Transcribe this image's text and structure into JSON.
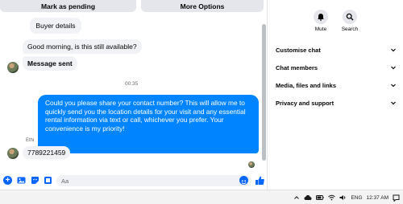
{
  "header_actions": {
    "mark_pending": "Mark as pending",
    "more_options": "More Options"
  },
  "messages": {
    "buyer_details": "Buyer details",
    "m1": "Good morning, is this still available?",
    "m2": "Message sent",
    "timestamp": "00:35",
    "outgoing": "Could you please share your contact number? This will allow me to quickly send you the location details for your visit and any essential rental information via text or call, whichever you prefer. Your convenience is my priority!",
    "sender_name": "Ethi",
    "phone": "7789221459"
  },
  "composer": {
    "placeholder": "Aa"
  },
  "panel": {
    "mute": "Mute",
    "search": "Search",
    "rows": [
      "Customise chat",
      "Chat members",
      "Media, files and links",
      "Privacy and support"
    ]
  },
  "taskbar": {
    "language": "ENG",
    "time": "12:37 AM"
  },
  "colors": {
    "accent": "#0084ff",
    "bubble_gray": "#f0f2f5"
  }
}
